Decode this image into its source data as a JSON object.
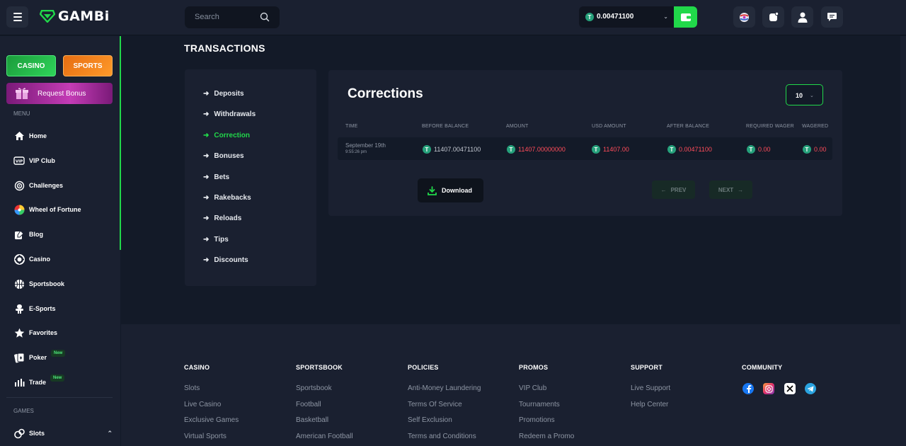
{
  "brand": {
    "name": "GAMBi"
  },
  "search": {
    "placeholder": "Search"
  },
  "balance": {
    "value": "0.00471100"
  },
  "sidebar": {
    "casino_label": "CASINO",
    "sports_label": "SPORTS",
    "bonus_label": "Request Bonus",
    "menu_heading": "MENU",
    "items": [
      {
        "label": "Home"
      },
      {
        "label": "VIP Club"
      },
      {
        "label": "Challenges"
      },
      {
        "label": "Wheel of Fortune"
      },
      {
        "label": "Blog"
      },
      {
        "label": "Casino"
      },
      {
        "label": "Sportsbook"
      },
      {
        "label": "E-Sports"
      },
      {
        "label": "Favorites"
      },
      {
        "label": "Poker",
        "badge": "New"
      },
      {
        "label": "Trade",
        "badge": "New"
      }
    ],
    "games_heading": "GAMES",
    "games_items": [
      {
        "label": "Slots"
      }
    ]
  },
  "page": {
    "title": "TRANSACTIONS"
  },
  "tx_menu": [
    "Deposits",
    "Withdrawals",
    "Correction",
    "Bonuses",
    "Bets",
    "Rakebacks",
    "Reloads",
    "Tips",
    "Discounts"
  ],
  "tx_menu_active": "Correction",
  "panel": {
    "title": "Corrections",
    "per_page": "10",
    "columns": [
      "TIME",
      "BEFORE BALANCE",
      "AMOUNT",
      "USD AMOUNT",
      "AFTER BALANCE",
      "REQUIRED WAGER",
      "WAGERED"
    ],
    "rows": [
      {
        "date": "September 19th",
        "time": "9:55:26 pm",
        "before_balance": "11407.00471100",
        "amount": "11407.00000000",
        "usd_amount": "11407.00",
        "after_balance": "0.00471100",
        "required_wager": "0.00",
        "wagered": "0.00"
      }
    ],
    "download_label": "Download",
    "prev_label": "PREV",
    "next_label": "NEXT"
  },
  "footer": {
    "columns": [
      {
        "title": "CASINO",
        "links": [
          "Slots",
          "Live Casino",
          "Exclusive Games",
          "Virtual Sports"
        ]
      },
      {
        "title": "SPORTSBOOK",
        "links": [
          "Sportsbook",
          "Football",
          "Basketball",
          "American Football"
        ]
      },
      {
        "title": "POLICIES",
        "links": [
          "Anti-Money Laundering",
          "Terms Of Service",
          "Self Exclusion",
          "Terms and Conditions"
        ]
      },
      {
        "title": "PROMOS",
        "links": [
          "VIP Club",
          "Tournaments",
          "Promotions",
          "Redeem a Promo"
        ]
      },
      {
        "title": "SUPPORT",
        "links": [
          "Live Support",
          "Help Center"
        ]
      },
      {
        "title": "COMMUNITY",
        "links": []
      }
    ],
    "social": [
      "facebook-icon",
      "instagram-icon",
      "x-icon",
      "telegram-icon"
    ]
  },
  "colors": {
    "accent": "#21d84a",
    "negative": "#ff4c5a",
    "background": "#131a28",
    "panel": "#1a2030"
  }
}
